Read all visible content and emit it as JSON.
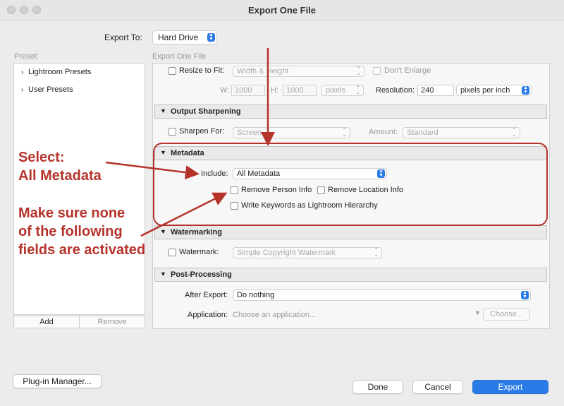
{
  "window": {
    "title": "Export One File"
  },
  "export_to": {
    "label": "Export To:",
    "value": "Hard Drive"
  },
  "preset": {
    "header": "Preset:",
    "items": [
      "Lightroom Presets",
      "User Presets"
    ],
    "add_label": "Add",
    "remove_label": "Remove"
  },
  "panel_header": "Export One File",
  "image_sizing": {
    "resize_label": "Resize to Fit:",
    "resize_mode": "Width & Height",
    "dont_enlarge": "Don't Enlarge",
    "w_label": "W:",
    "w_value": "1000",
    "h_label": "H:",
    "h_value": "1000",
    "unit": "pixels",
    "resolution_label": "Resolution:",
    "resolution_value": "240",
    "resolution_unit": "pixels per inch"
  },
  "output_sharpening": {
    "title": "Output Sharpening",
    "sharpen_label": "Sharpen For:",
    "sharpen_value": "Screen",
    "amount_label": "Amount:",
    "amount_value": "Standard"
  },
  "metadata": {
    "title": "Metadata",
    "include_label": "Include:",
    "include_value": "All Metadata",
    "remove_person": "Remove Person Info",
    "remove_location": "Remove Location Info",
    "write_keywords": "Write Keywords as Lightroom Hierarchy"
  },
  "watermarking": {
    "title": "Watermarking",
    "watermark_label": "Watermark:",
    "watermark_value": "Simple Copyright Watermark"
  },
  "post_processing": {
    "title": "Post-Processing",
    "after_export_label": "After Export:",
    "after_export_value": "Do nothing",
    "application_label": "Application:",
    "application_placeholder": "Choose an application...",
    "choose_label": "Choose..."
  },
  "buttons": {
    "plugin_manager": "Plug-in Manager...",
    "done": "Done",
    "cancel": "Cancel",
    "export": "Export"
  },
  "annotations": {
    "select_line1": "Select:",
    "select_line2": "All Metadata",
    "make_sure_line1": "Make sure none",
    "make_sure_line2": "of the following",
    "make_sure_line3": "fields are activated"
  },
  "colors": {
    "annotation": "#b5332b",
    "accent_blue": "#2a7ae8"
  }
}
